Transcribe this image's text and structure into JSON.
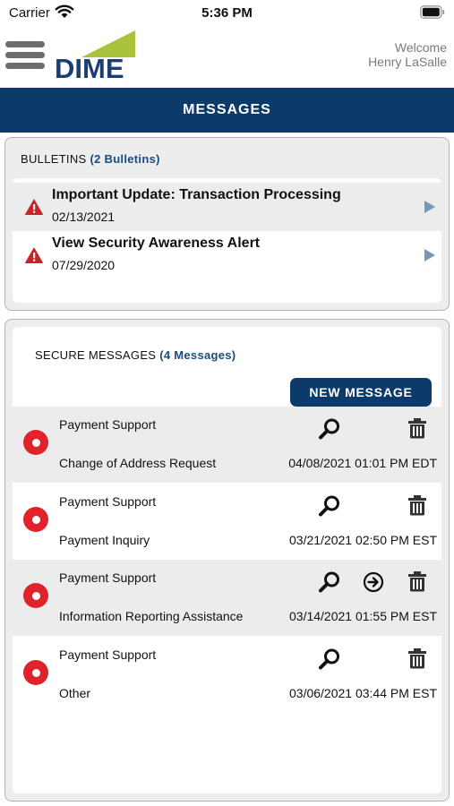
{
  "status_bar": {
    "carrier": "Carrier",
    "time": "5:36 PM"
  },
  "header": {
    "logo_text": "DIME",
    "welcome_line1": "Welcome",
    "welcome_line2": "Henry LaSalle"
  },
  "page_title": "MESSAGES",
  "bulletins": {
    "title": "BULLETINS",
    "count_label": "(2 Bulletins)",
    "items": [
      {
        "title": "Important Update: Transaction Processing",
        "date": "02/13/2021"
      },
      {
        "title": "View Security Awareness Alert",
        "date": "07/29/2020"
      }
    ]
  },
  "secure_messages": {
    "title": "SECURE MESSAGES",
    "count_label": "(4 Messages)",
    "new_message_label": "NEW MESSAGE",
    "items": [
      {
        "from": "Payment Support",
        "subject": "Change of Address Request",
        "date": "04/08/2021 01:01 PM EDT"
      },
      {
        "from": "Payment Support",
        "subject": "Payment Inquiry",
        "date": "03/21/2021 02:50 PM EST"
      },
      {
        "from": "Payment Support",
        "subject": "Information Reporting Assistance",
        "date": "03/14/2021 01:55 PM EST"
      },
      {
        "from": "Payment Support",
        "subject": "Other",
        "date": "03/06/2021 03:44 PM EST"
      }
    ]
  },
  "colors": {
    "brand_navy": "#0c3a6b",
    "alert_red": "#e0232a",
    "logo_green": "#a8c23b"
  },
  "icons": [
    "wifi-icon",
    "battery-icon",
    "menu-icon",
    "warning-icon",
    "play-arrow-icon",
    "view-icon",
    "forward-icon",
    "trash-icon"
  ]
}
